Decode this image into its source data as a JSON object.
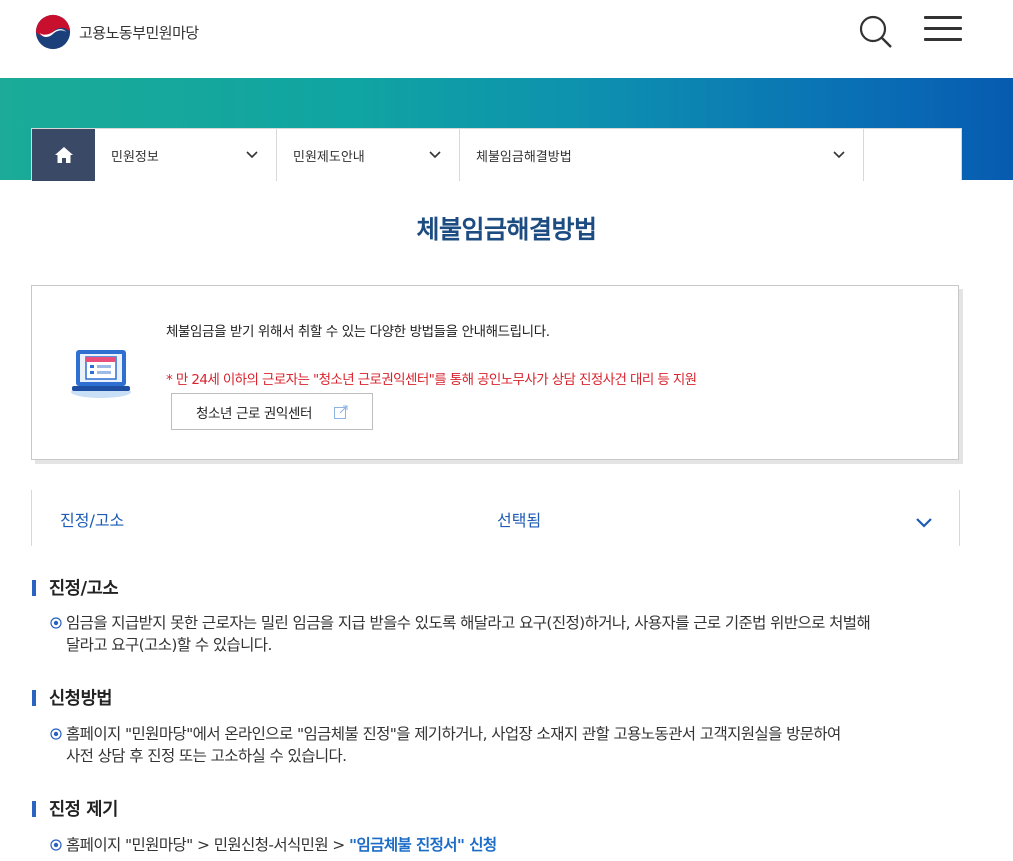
{
  "header": {
    "site_name": "고용노동부민원마당"
  },
  "breadcrumb": {
    "items": [
      {
        "label": "민원정보"
      },
      {
        "label": "민원제도안내"
      },
      {
        "label": "체불임금해결방법"
      }
    ]
  },
  "page": {
    "title": "체불임금해결방법"
  },
  "info": {
    "text": "체불임금을 받기 위해서 취할 수 있는 다양한 방법들을 안내해드립니다.",
    "warning": "* 만 24세 이하의 근로자는 \"청소년 근로권익센터\"를 통해 공인노무사가 상담 진정사건 대리 등 지원",
    "button_label": "청소년 근로 권익센터"
  },
  "selector": {
    "label": "진정/고소",
    "state": "선택됨"
  },
  "sections": [
    {
      "heading": "진정/고소",
      "line1": "임금을 지급받지 못한 근로자는 밀린 임금을 지급 받을수 있도록 해달라고 요구(진정)하거나, 사용자를 근로 기준법 위반으로 처벌해",
      "line2": "달라고 요구(고소)할 수 있습니다."
    },
    {
      "heading": "신청방법",
      "line1": "홈페이지 \"민원마당\"에서 온라인으로 \"임금체불 진정\"을 제기하거나, 사업장 소재지 관할 고용노동관서 고객지원실을 방문하여",
      "line2": "사전 상담 후 진정 또는 고소하실 수 있습니다."
    },
    {
      "heading": "진정 제기",
      "line1": "홈페이지 \"민원마당\" > 민원신청-서식민원 > ",
      "link": "\"임금체불 진정서\" 신청"
    }
  ],
  "colors": {
    "title": "#1d4c82",
    "warning": "#d9232d",
    "link": "#1d6dc7",
    "home_bg": "#3a4a66"
  }
}
